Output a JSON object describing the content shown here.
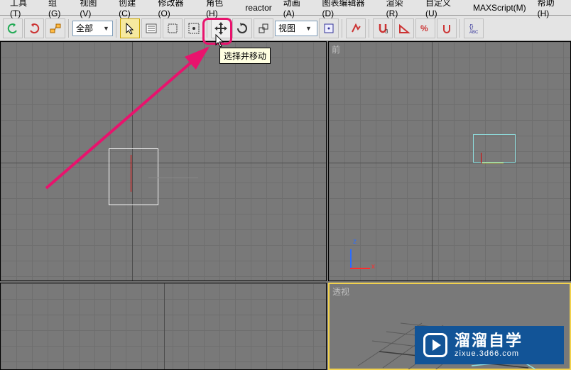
{
  "menu": {
    "tools": "工具(T)",
    "group": "组(G)",
    "views": "视图(V)",
    "create": "创建(C)",
    "modifiers": "修改器(O)",
    "character": "角色(H)",
    "reactor": "reactor",
    "animation": "动画(A)",
    "graph": "图表编辑器(D)",
    "render": "渲染(R)",
    "customize": "自定义(U)",
    "maxscript": "MAXScript(M)",
    "help": "帮助(H)"
  },
  "toolbar": {
    "filter_dropdown": "全部",
    "view_dropdown": "视图"
  },
  "tooltip": "选择并移动",
  "viewports": {
    "front": "前",
    "persp": "透视"
  },
  "watermark": {
    "title": "溜溜自学",
    "url": "zixue.3d66.com"
  }
}
